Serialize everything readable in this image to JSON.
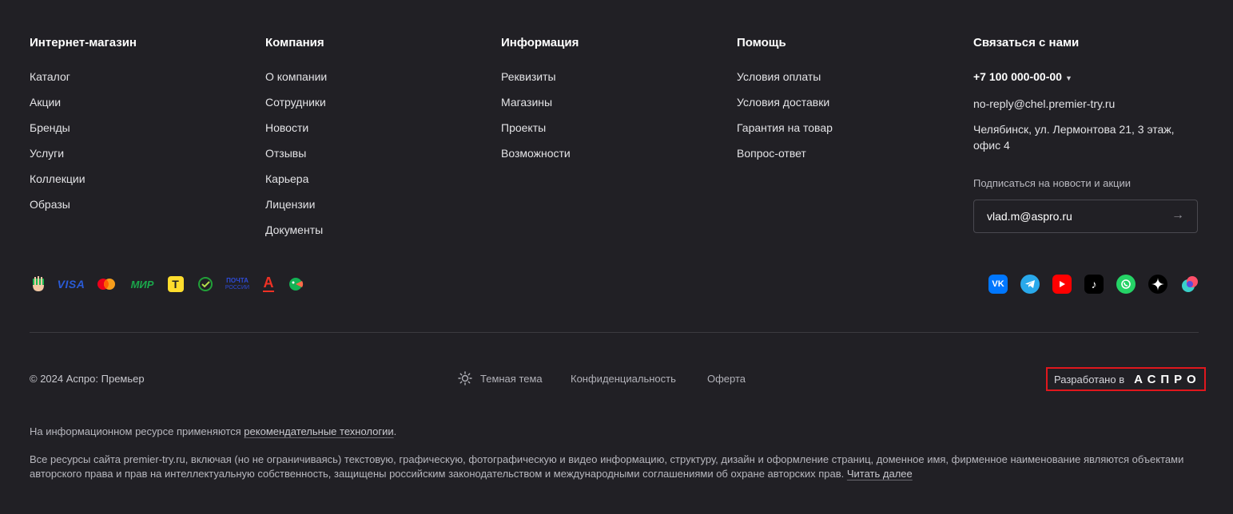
{
  "columns": {
    "shop": {
      "title": "Интернет-магазин",
      "items": [
        "Каталог",
        "Акции",
        "Бренды",
        "Услуги",
        "Коллекции",
        "Образы"
      ]
    },
    "company": {
      "title": "Компания",
      "items": [
        "О компании",
        "Сотрудники",
        "Новости",
        "Отзывы",
        "Карьера",
        "Лицензии",
        "Документы"
      ]
    },
    "info": {
      "title": "Информация",
      "items": [
        "Реквизиты",
        "Магазины",
        "Проекты",
        "Возможности"
      ]
    },
    "help": {
      "title": "Помощь",
      "items": [
        "Условия оплаты",
        "Условия доставки",
        "Гарантия на товар",
        "Вопрос-ответ"
      ]
    }
  },
  "contact": {
    "title": "Связаться с нами",
    "phone": "+7 100 000-00-00",
    "email": "no-reply@chel.premier-try.ru",
    "address": "Челябинск, ул. Лермонтова 21, 3 этаж, офис 4"
  },
  "subscribe": {
    "label": "Подписаться на новости и акции",
    "value": "vlad.m@aspro.ru"
  },
  "payments": {
    "visa": "VISA",
    "mir": "МИР",
    "tinkoff": "T",
    "pochta_line1": "ПОЧТА",
    "pochta_line2": "РОССИИ",
    "alfa": "А"
  },
  "social_icons": [
    "vk-icon",
    "telegram-icon",
    "youtube-icon",
    "tiktok-icon",
    "whatsapp-icon",
    "dzen-icon",
    "colorful-icon"
  ],
  "social_text": {
    "vk": "VK",
    "tiktok": "♪"
  },
  "bottom": {
    "copyright": "© 2024 Аспро: Премьер",
    "theme": "Темная тема",
    "privacy": "Конфиденциальность",
    "offer": "Оферта",
    "developed_by": "Разработано в",
    "dev_logo": "АСПРО"
  },
  "notes": {
    "rec_prefix": "На информационном ресурсе применяются ",
    "rec_link": "рекомендательные технологии",
    "rec_suffix": ".",
    "rights_text": "Все ресурсы сайта premier-try.ru, включая (но не ограничиваясь) текстовую, графическую, фотографическую и видео информацию, структуру, дизайн и оформление страниц, доменное имя, фирменное наименование являются объектами авторского права и прав на интеллектуальную собственность, защищены российским законодательством и международными соглашениями об охране авторских прав. ",
    "rights_link": "Читать далее"
  },
  "colors": {
    "background": "#212025",
    "highlight_border": "#e0171d",
    "vk": "#0077ff",
    "telegram": "#29a9eb",
    "youtube": "#ff0000",
    "whatsapp": "#25d366"
  }
}
